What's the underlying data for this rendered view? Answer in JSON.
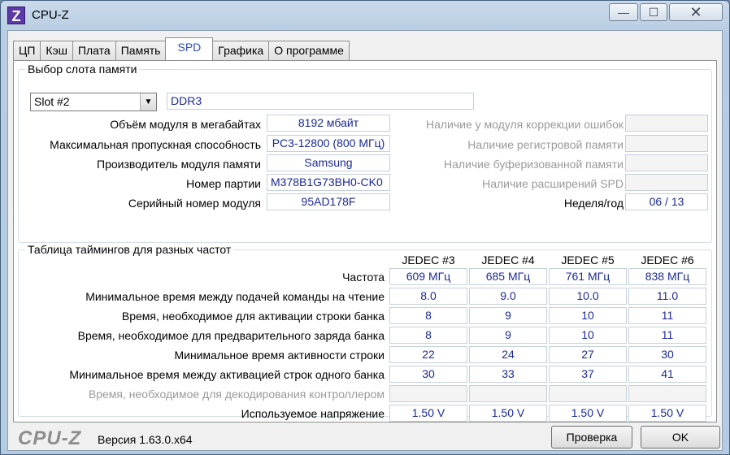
{
  "window": {
    "title": "CPU-Z",
    "icon": "Z",
    "minimize": "—",
    "maximize": "☐",
    "close": "✕"
  },
  "tabs": [
    "ЦП",
    "Кэш",
    "Плата",
    "Память",
    "SPD",
    "Графика",
    "О программе"
  ],
  "active_tab": "SPD",
  "slot_group": {
    "legend": "Выбор слота памяти",
    "slot_selected": "Slot #2",
    "memory_type": "DDR3",
    "left_rows": [
      {
        "label": "Объём модуля в мегабайтах",
        "value": "8192 мбайт"
      },
      {
        "label": "Максимальная пропускная способность",
        "value": "PC3-12800 (800 МГц)"
      },
      {
        "label": "Производитель модуля памяти",
        "value": "Samsung"
      },
      {
        "label": "Номер партии",
        "value": "M378B1G73BH0-CK0"
      },
      {
        "label": "Серийный номер модуля",
        "value": "95AD178F"
      }
    ],
    "right_rows": [
      {
        "label": "Наличие у модуля коррекции ошибок",
        "value": ""
      },
      {
        "label": "Наличие регистровой памяти",
        "value": ""
      },
      {
        "label": "Наличие буферизованной памяти",
        "value": ""
      },
      {
        "label": "Наличие расширений SPD",
        "value": ""
      },
      {
        "label": "Неделя/год",
        "value": "06 / 13"
      }
    ]
  },
  "timings_group": {
    "legend": "Таблица таймингов для разных частот",
    "columns": [
      "JEDEC #3",
      "JEDEC #4",
      "JEDEC #5",
      "JEDEC #6"
    ],
    "rows": [
      {
        "label": "Частота",
        "values": [
          "609 МГц",
          "685 МГц",
          "761 МГц",
          "838 МГц"
        ]
      },
      {
        "label": "Минимальное время между подачей команды на чтение",
        "values": [
          "8.0",
          "9.0",
          "10.0",
          "11.0"
        ]
      },
      {
        "label": "Время, необходимое для активации строки банка",
        "values": [
          "8",
          "9",
          "10",
          "11"
        ]
      },
      {
        "label": "Время, необходимое для предварительного заряда банка",
        "values": [
          "8",
          "9",
          "10",
          "11"
        ]
      },
      {
        "label": "Минимальное время активности строки",
        "values": [
          "22",
          "24",
          "27",
          "30"
        ]
      },
      {
        "label": "Минимальное время между активацией строк одного банка",
        "values": [
          "30",
          "33",
          "37",
          "41"
        ]
      },
      {
        "label": "Время, необходимое для декодирования контроллером",
        "values": [
          "",
          "",
          "",
          ""
        ]
      },
      {
        "label": "Используемое напряжение",
        "values": [
          "1.50 V",
          "1.50 V",
          "1.50 V",
          "1.50 V"
        ]
      }
    ]
  },
  "footer": {
    "logo": "CPU-Z",
    "version": "Версия 1.63.0.x64",
    "validate_label": "Проверка",
    "ok_label": "OK"
  }
}
